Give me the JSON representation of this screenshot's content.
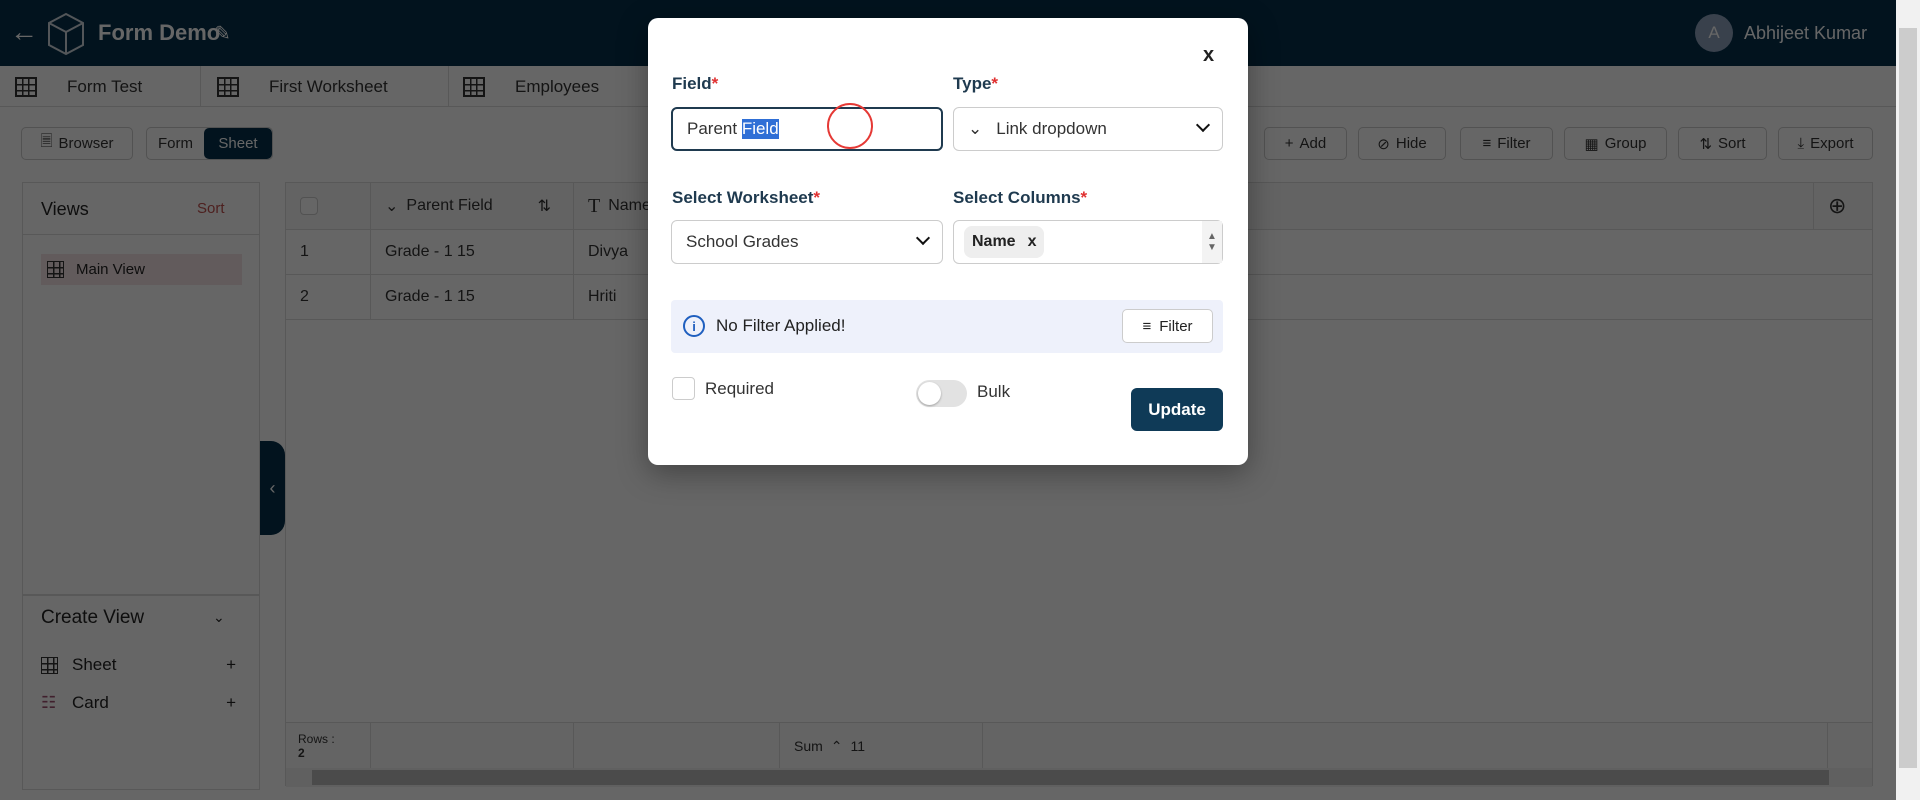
{
  "header": {
    "title": "Form Demo",
    "user_initial": "A",
    "user_name": "Abhijeet Kumar"
  },
  "tabs": [
    {
      "label": "Form Test"
    },
    {
      "label": "First Worksheet"
    },
    {
      "label": "Employees"
    }
  ],
  "toolbar": {
    "browser": "Browser",
    "form": "Form",
    "sheet": "Sheet",
    "add": "Add",
    "hide": "Hide",
    "filter": "Filter",
    "group": "Group",
    "sort": "Sort",
    "export": "Export"
  },
  "views": {
    "title": "Views",
    "sort": "Sort",
    "items": [
      {
        "label": "Main View"
      }
    ],
    "create_title": "Create View",
    "create_items": [
      {
        "label": "Sheet"
      },
      {
        "label": "Card"
      }
    ]
  },
  "grid": {
    "columns": [
      "Parent Field",
      "Name"
    ],
    "rows": [
      {
        "n": "1",
        "parent": "Grade - 1 15",
        "name": "Divya"
      },
      {
        "n": "2",
        "parent": "Grade - 1 15",
        "name": "Hriti"
      }
    ],
    "footer": {
      "rows_label": "Rows :",
      "rows_value": "2",
      "sum_label": "Sum",
      "sum_value": "11"
    }
  },
  "modal": {
    "close": "x",
    "field_label": "Field",
    "field_value_plain": "Parent ",
    "field_value_selected": "Field",
    "type_label": "Type",
    "type_value": "Link dropdown",
    "worksheet_label": "Select Worksheet",
    "worksheet_value": "School Grades",
    "columns_label": "Select Columns",
    "columns_chip": "Name",
    "chip_remove": "x",
    "filter_info": "No Filter Applied!",
    "filter_button": "Filter",
    "required_label": "Required",
    "required_checked": false,
    "bulk_label": "Bulk",
    "bulk_on": false,
    "update": "Update",
    "asterisk": "*"
  },
  "colors": {
    "brand": "#04304c",
    "accent_red": "#e03030",
    "selection": "#2f6fd6"
  }
}
